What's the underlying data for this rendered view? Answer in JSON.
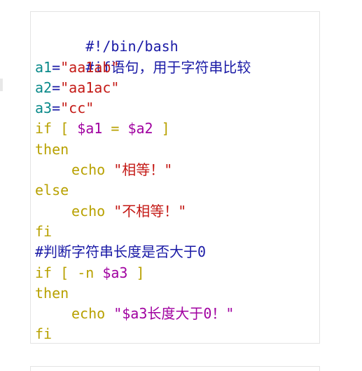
{
  "code": {
    "shebang": "#!/bin/bash",
    "comment_if": "#if语句，用于字符串比较",
    "a1_var": "a1",
    "a1_eq": "=",
    "a1_val": "\"aa1ab\"",
    "a2_var": "a2",
    "a2_eq": "=",
    "a2_val": "\"aa1ac\"",
    "a3_var": "a3",
    "a3_eq": "=",
    "a3_val": "\"cc\"",
    "if1_kw": "if [ ",
    "if1_a1": "$a1",
    "if1_op": " = ",
    "if1_a2": "$a2",
    "if1_close": " ]",
    "then1": "then",
    "echo1_kw": "echo ",
    "echo1_str": "\"相等！\"",
    "else": "else",
    "echo2_kw": "echo ",
    "echo2_str": "\"不相等！\"",
    "fi1": "fi",
    "comment_len": "#判断字符串长度是否大于0",
    "if2_kw": "if [ -n ",
    "if2_a3": "$a3",
    "if2_close": " ]",
    "then2": "then",
    "echo3_kw": "echo ",
    "echo3_str": "\"$a3长度大于0！\"",
    "fi2": "fi"
  }
}
